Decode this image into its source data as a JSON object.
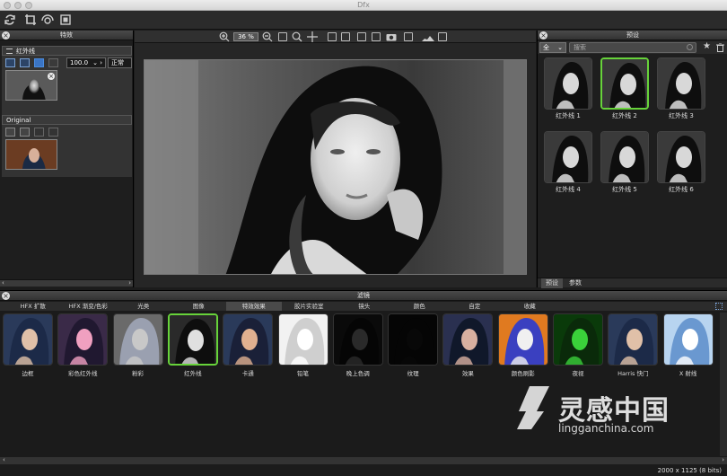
{
  "window": {
    "title": "Dfx"
  },
  "effects_panel": {
    "title": "特效",
    "layer1": {
      "name": "红外线",
      "value": "100.0",
      "mode": "正常"
    },
    "layer2": {
      "name": "Original"
    }
  },
  "view": {
    "zoom": "36 %"
  },
  "presets_panel": {
    "title": "预设",
    "category": "全",
    "search_placeholder": "搜索",
    "items": [
      "红外线 1",
      "红外线 2",
      "红外线 3",
      "红外线 4",
      "红外线 5",
      "红外线 6"
    ],
    "selected_index": 1,
    "tabs": [
      "预设",
      "参数"
    ],
    "active_tab": 0
  },
  "filters_panel": {
    "title": "滤镜",
    "categories": [
      "HFX 扩散",
      "HFX 渐变/色彩",
      "光类",
      "图像",
      "特效效果",
      "胶片实验室",
      "镜头",
      "颜色",
      "自定",
      "收藏"
    ],
    "active_category": 4,
    "filters": [
      "边框",
      "彩色红外线",
      "粉彩",
      "红外线",
      "卡通",
      "铅笔",
      "晚上色调",
      "纹理",
      "效果",
      "颜色刷影",
      "夜视",
      "Harris 快门",
      "X 射线"
    ],
    "selected_index": 3
  },
  "status": {
    "dimensions": "2000 x 1125 (8 bits)"
  },
  "watermark": {
    "logo_text": "灵感中国",
    "url": "lingganchina.com"
  },
  "colors": {
    "accent_green": "#67d33a",
    "panel_bg": "#1e1e1e"
  }
}
